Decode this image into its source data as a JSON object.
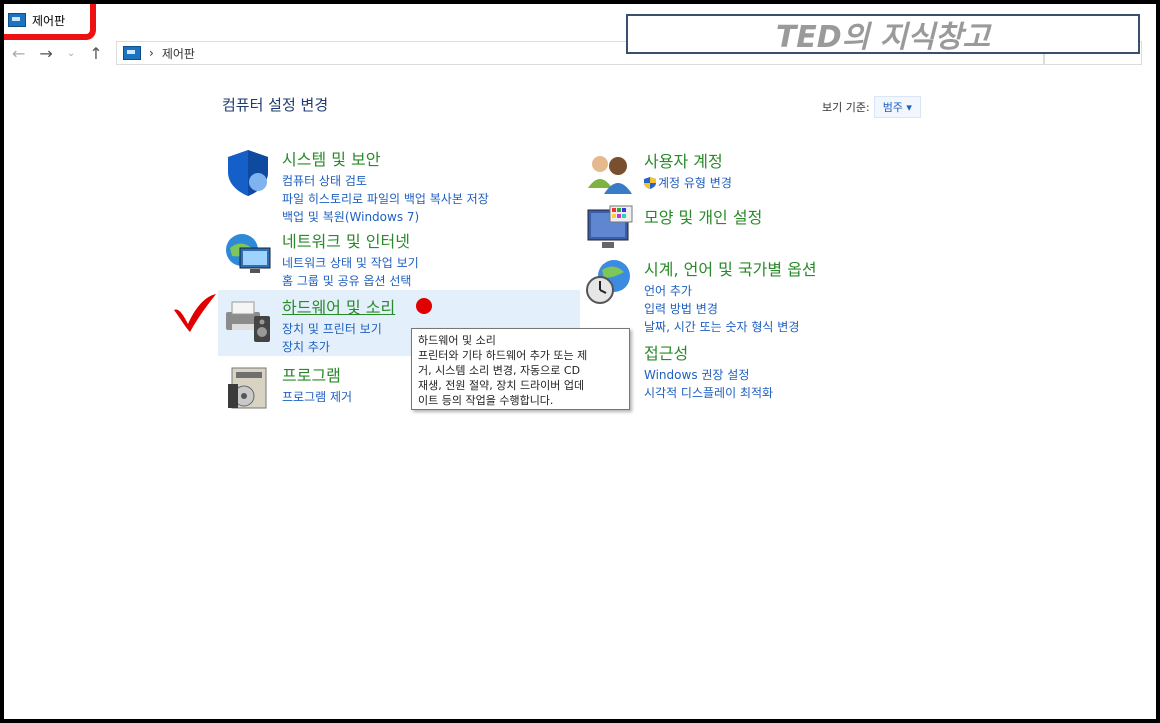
{
  "window": {
    "title": "제어판"
  },
  "address": {
    "path": "제어판"
  },
  "watermark": "TED의 지식창고",
  "heading": "컴퓨터 설정 변경",
  "view_by": {
    "label": "보기 기준:",
    "value": "범주"
  },
  "left_categories": [
    {
      "title": "시스템 및 보안",
      "links": [
        "컴퓨터 상태 검토",
        "파일 히스토리로 파일의 백업 복사본 저장",
        "백업 및 복원(Windows 7)"
      ]
    },
    {
      "title": "네트워크 및 인터넷",
      "links": [
        "네트워크 상태 및 작업 보기",
        "홈 그룹 및 공유 옵션 선택"
      ]
    },
    {
      "title": "하드웨어 및 소리",
      "links": [
        "장치 및 프린터 보기",
        "장치 추가"
      ]
    },
    {
      "title": "프로그램",
      "links": [
        "프로그램 제거"
      ]
    }
  ],
  "right_categories": [
    {
      "title": "사용자 계정",
      "links": [
        "계정 유형 변경"
      ]
    },
    {
      "title": "모양 및 개인 설정",
      "links": []
    },
    {
      "title": "시계, 언어 및 국가별 옵션",
      "links": [
        "언어 추가",
        "입력 방법 변경",
        "날짜, 시간 또는 숫자 형식 변경"
      ]
    },
    {
      "title": "접근성",
      "links": [
        "Windows 권장 설정",
        "시각적 디스플레이 최적화"
      ]
    }
  ],
  "tooltip": {
    "title": "하드웨어 및 소리",
    "lines": [
      "프린터와 기타 하드웨어 추가 또는 제",
      "거, 시스템 소리 변경, 자동으로 CD",
      "재생, 전원 절약, 장치 드라이버 업데",
      "이트 등의 작업을 수행합니다."
    ]
  },
  "colors": {
    "category_title": "#2a8a2a",
    "link": "#1f5fc0",
    "highlight": "#e3f0fb",
    "annotation": "#e00000"
  }
}
